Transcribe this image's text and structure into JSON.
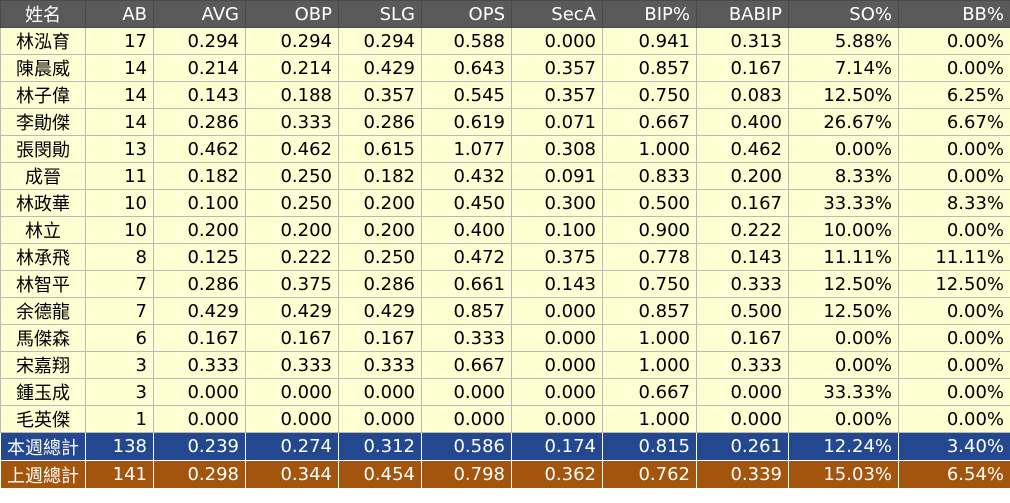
{
  "columns": [
    "姓名",
    "AB",
    "AVG",
    "OBP",
    "SLG",
    "OPS",
    "SecA",
    "BIP%",
    "BABIP",
    "SO%",
    "BB%"
  ],
  "rows": [
    [
      "林泓育",
      "17",
      "0.294",
      "0.294",
      "0.294",
      "0.588",
      "0.000",
      "0.941",
      "0.313",
      "5.88%",
      "0.00%"
    ],
    [
      "陳晨威",
      "14",
      "0.214",
      "0.214",
      "0.429",
      "0.643",
      "0.357",
      "0.857",
      "0.167",
      "7.14%",
      "0.00%"
    ],
    [
      "林子偉",
      "14",
      "0.143",
      "0.188",
      "0.357",
      "0.545",
      "0.357",
      "0.750",
      "0.083",
      "12.50%",
      "6.25%"
    ],
    [
      "李勛傑",
      "14",
      "0.286",
      "0.333",
      "0.286",
      "0.619",
      "0.071",
      "0.667",
      "0.400",
      "26.67%",
      "6.67%"
    ],
    [
      "張閔勛",
      "13",
      "0.462",
      "0.462",
      "0.615",
      "1.077",
      "0.308",
      "1.000",
      "0.462",
      "0.00%",
      "0.00%"
    ],
    [
      "成晉",
      "11",
      "0.182",
      "0.250",
      "0.182",
      "0.432",
      "0.091",
      "0.833",
      "0.200",
      "8.33%",
      "0.00%"
    ],
    [
      "林政華",
      "10",
      "0.100",
      "0.250",
      "0.200",
      "0.450",
      "0.300",
      "0.500",
      "0.167",
      "33.33%",
      "8.33%"
    ],
    [
      "林立",
      "10",
      "0.200",
      "0.200",
      "0.200",
      "0.400",
      "0.100",
      "0.900",
      "0.222",
      "10.00%",
      "0.00%"
    ],
    [
      "林承飛",
      "8",
      "0.125",
      "0.222",
      "0.250",
      "0.472",
      "0.375",
      "0.778",
      "0.143",
      "11.11%",
      "11.11%"
    ],
    [
      "林智平",
      "7",
      "0.286",
      "0.375",
      "0.286",
      "0.661",
      "0.143",
      "0.750",
      "0.333",
      "12.50%",
      "12.50%"
    ],
    [
      "余德龍",
      "7",
      "0.429",
      "0.429",
      "0.429",
      "0.857",
      "0.000",
      "0.857",
      "0.500",
      "12.50%",
      "0.00%"
    ],
    [
      "馬傑森",
      "6",
      "0.167",
      "0.167",
      "0.167",
      "0.333",
      "0.000",
      "1.000",
      "0.167",
      "0.00%",
      "0.00%"
    ],
    [
      "宋嘉翔",
      "3",
      "0.333",
      "0.333",
      "0.333",
      "0.667",
      "0.000",
      "1.000",
      "0.333",
      "0.00%",
      "0.00%"
    ],
    [
      "鍾玉成",
      "3",
      "0.000",
      "0.000",
      "0.000",
      "0.000",
      "0.000",
      "0.667",
      "0.000",
      "33.33%",
      "0.00%"
    ],
    [
      "毛英傑",
      "1",
      "0.000",
      "0.000",
      "0.000",
      "0.000",
      "0.000",
      "1.000",
      "0.000",
      "0.00%",
      "0.00%"
    ]
  ],
  "totals": [
    [
      "本週總計",
      "138",
      "0.239",
      "0.274",
      "0.312",
      "0.586",
      "0.174",
      "0.815",
      "0.261",
      "12.24%",
      "3.40%"
    ],
    [
      "上週總計",
      "141",
      "0.298",
      "0.344",
      "0.454",
      "0.798",
      "0.362",
      "0.762",
      "0.339",
      "15.03%",
      "6.54%"
    ]
  ],
  "colors": {
    "header_bg": "#5a5a5a",
    "row_bg": "#fefed2",
    "this_week_bg": "#23488f",
    "last_week_bg": "#a3540d"
  }
}
